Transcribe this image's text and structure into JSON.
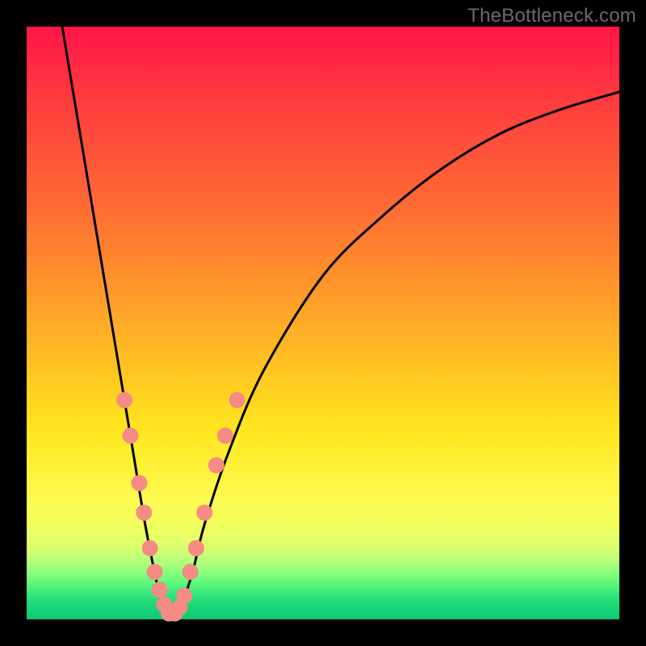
{
  "watermark": "TheBottleneck.com",
  "colors": {
    "frame": "#000000",
    "curve": "#000000",
    "dot_fill": "#f48b84",
    "dot_stroke": "#d46b64"
  },
  "chart_data": {
    "type": "line",
    "title": "",
    "xlabel": "",
    "ylabel": "",
    "xlim": [
      0,
      100
    ],
    "ylim": [
      0,
      100
    ],
    "series": [
      {
        "name": "bottleneck-curve",
        "x": [
          6,
          8,
          10,
          12,
          14,
          16,
          18,
          20,
          22,
          23,
          24,
          25,
          26,
          28,
          30,
          34,
          40,
          50,
          60,
          70,
          80,
          90,
          100
        ],
        "y": [
          100,
          88,
          76,
          64,
          52,
          40,
          28,
          16,
          6,
          2,
          0,
          0,
          2,
          8,
          16,
          28,
          42,
          58,
          68,
          76,
          82,
          86,
          89
        ]
      }
    ],
    "highlight_points": {
      "name": "markers",
      "points": [
        {
          "x": 16.5,
          "y": 37
        },
        {
          "x": 17.5,
          "y": 31
        },
        {
          "x": 19.0,
          "y": 23
        },
        {
          "x": 19.8,
          "y": 18
        },
        {
          "x": 20.8,
          "y": 12
        },
        {
          "x": 21.6,
          "y": 8
        },
        {
          "x": 22.4,
          "y": 5
        },
        {
          "x": 23.2,
          "y": 2.5
        },
        {
          "x": 24.0,
          "y": 1
        },
        {
          "x": 25.0,
          "y": 1
        },
        {
          "x": 25.8,
          "y": 2
        },
        {
          "x": 26.6,
          "y": 4
        },
        {
          "x": 27.6,
          "y": 8
        },
        {
          "x": 28.6,
          "y": 12
        },
        {
          "x": 30.0,
          "y": 18
        },
        {
          "x": 32.0,
          "y": 26
        },
        {
          "x": 33.5,
          "y": 31
        },
        {
          "x": 35.5,
          "y": 37
        }
      ]
    },
    "vertex_x_estimate": 24.5
  }
}
